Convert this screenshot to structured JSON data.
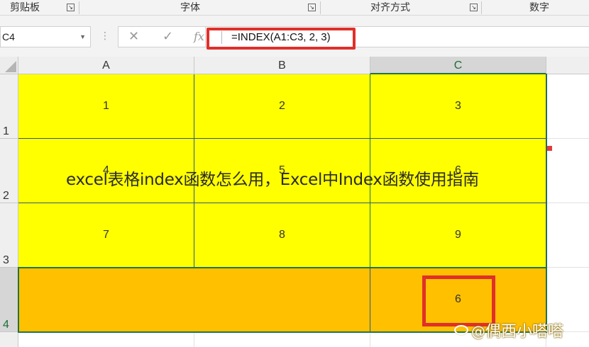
{
  "ribbon": {
    "groups": [
      {
        "label": "剪贴板"
      },
      {
        "label": "字体"
      },
      {
        "label": "对齐方式"
      },
      {
        "label": "数字"
      }
    ],
    "launcher_icon": "dialog-launcher-icon"
  },
  "formula_bar": {
    "name_box": "C4",
    "cancel_icon": "✕",
    "enter_icon": "✓",
    "fx_label": "fx",
    "formula": "=INDEX(A1:C3, 2, 3)"
  },
  "grid": {
    "columns": [
      "A",
      "B",
      "C"
    ],
    "rows": [
      "1",
      "2",
      "3",
      "4"
    ],
    "cells": [
      [
        "1",
        "2",
        "3"
      ],
      [
        "4",
        "5",
        "6"
      ],
      [
        "7",
        "8",
        "9"
      ],
      [
        "",
        "",
        "6"
      ]
    ],
    "selected_cell": "C4"
  },
  "colors": {
    "yellow_fill": "#ffff00",
    "orange_fill": "#ffc000",
    "highlight_red": "#e0302a",
    "selection_green": "#217346"
  },
  "caption": "excel表格index函数怎么用，Excel中Index函数使用指南",
  "watermark": {
    "at": "@",
    "text": "偶西小嗒嗒"
  }
}
